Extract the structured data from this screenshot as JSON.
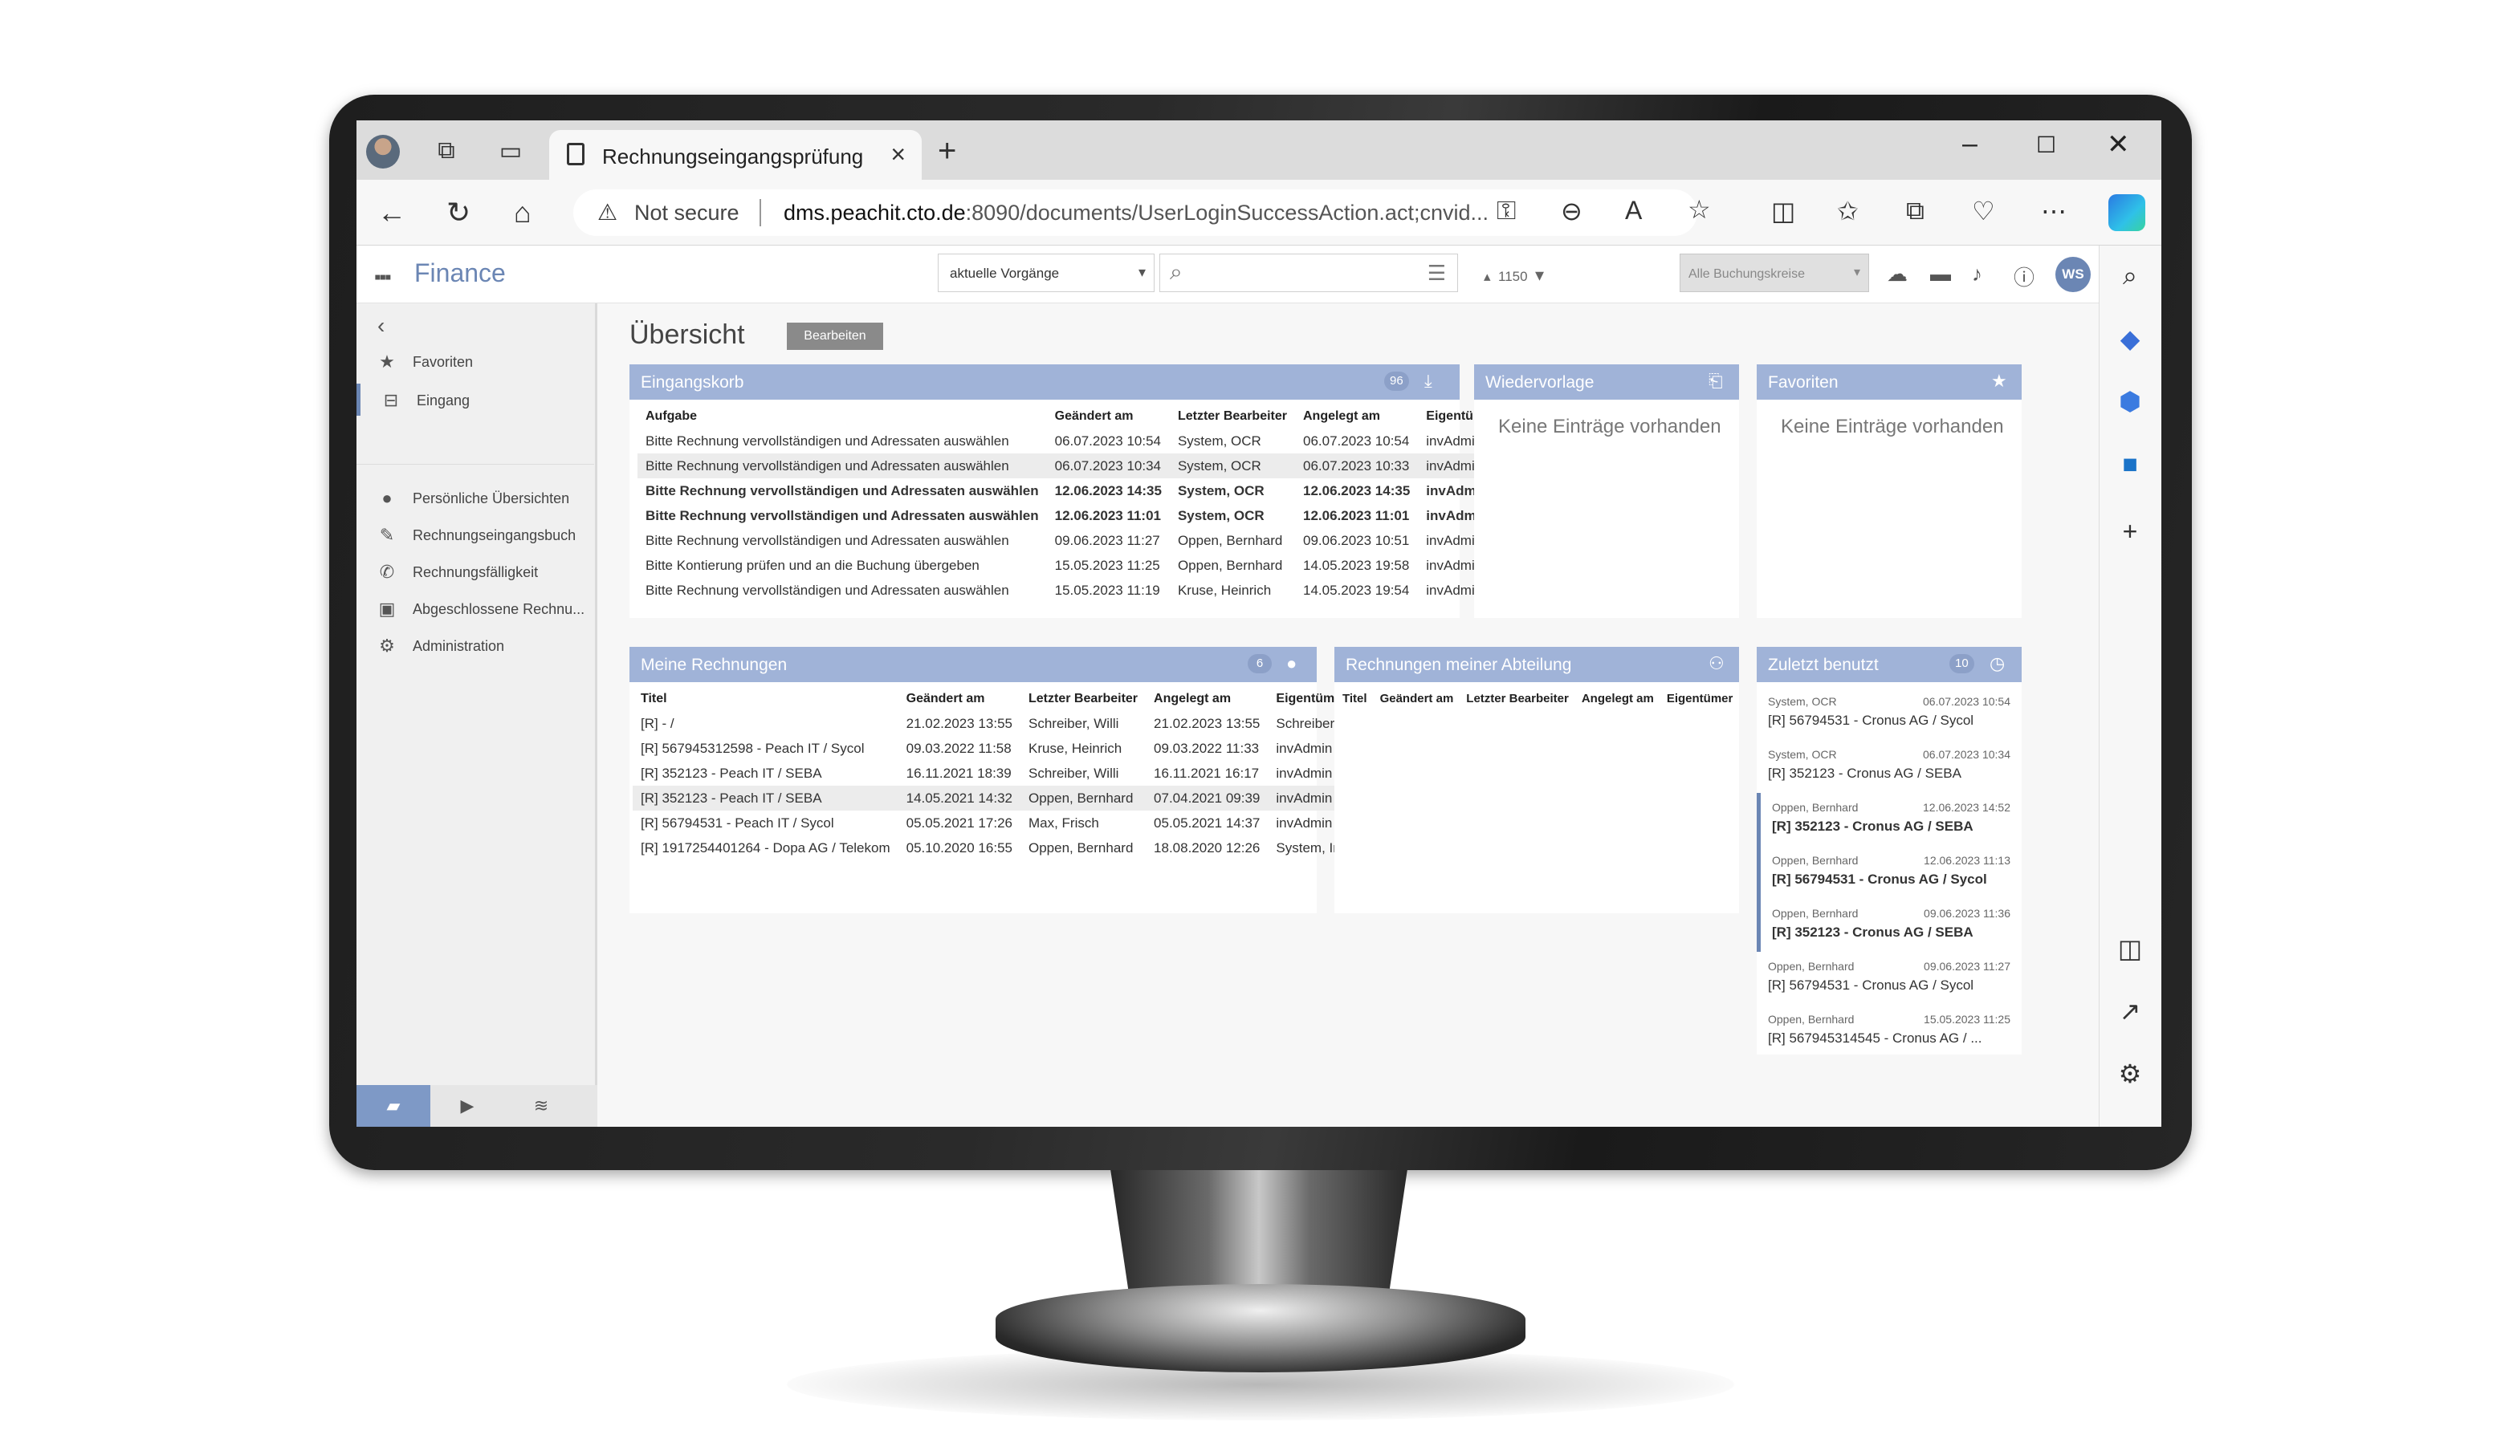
{
  "browser": {
    "tab_title": "Rechnungseingangsprüfung",
    "not_secure": "Not secure",
    "url_host": "dms.peachit.cto.de",
    "url_rest": ":8090/documents/UserLoginSuccessAction.act;cnvid..."
  },
  "app": {
    "title": "Finance",
    "filter_value": "aktuelle Vorgänge",
    "pager": "1150",
    "buchungskreis_value": "Alle Buchungskreise",
    "user_initials": "WS"
  },
  "sidebar": {
    "items": [
      {
        "label": "Favoriten",
        "icon": "star-icon"
      },
      {
        "label": "Eingang",
        "icon": "inbox-icon"
      },
      {
        "label": "Persönliche Übersichten",
        "icon": "person-icon"
      },
      {
        "label": "Rechnungseingangsbuch",
        "icon": "book-icon"
      },
      {
        "label": "Rechnungsfälligkeit",
        "icon": "due-icon"
      },
      {
        "label": "Abgeschlossene Rechnu...",
        "icon": "archive-icon"
      },
      {
        "label": "Administration",
        "icon": "gear-icon"
      }
    ]
  },
  "main": {
    "page_title": "Übersicht",
    "edit_label": "Bearbeiten"
  },
  "eingangskorb": {
    "title": "Eingangskorb",
    "count": "96",
    "columns": [
      "Aufgabe",
      "Geändert am",
      "Letzter Bearbeiter",
      "Angelegt am",
      "Eigentümer"
    ],
    "rows": [
      [
        "Bitte Rechnung vervollständigen und Adressaten auswählen",
        "06.07.2023 10:54",
        "System, OCR",
        "06.07.2023 10:54",
        "invAdmin"
      ],
      [
        "Bitte Rechnung vervollständigen und Adressaten auswählen",
        "06.07.2023 10:34",
        "System, OCR",
        "06.07.2023 10:33",
        "invAdmin"
      ],
      [
        "Bitte Rechnung vervollständigen und Adressaten auswählen",
        "12.06.2023 14:35",
        "System, OCR",
        "12.06.2023 14:35",
        "invAdmin"
      ],
      [
        "Bitte Rechnung vervollständigen und Adressaten auswählen",
        "12.06.2023 11:01",
        "System, OCR",
        "12.06.2023 11:01",
        "invAdmin"
      ],
      [
        "Bitte Rechnung vervollständigen und Adressaten auswählen",
        "09.06.2023 11:27",
        "Oppen, Bernhard",
        "09.06.2023 10:51",
        "invAdmin"
      ],
      [
        "Bitte Kontierung prüfen und an die Buchung übergeben",
        "15.05.2023 11:25",
        "Oppen, Bernhard",
        "14.05.2023 19:58",
        "invAdmin"
      ],
      [
        "Bitte Rechnung vervollständigen und Adressaten auswählen",
        "15.05.2023 11:19",
        "Kruse, Heinrich",
        "14.05.2023 19:54",
        "invAdmin"
      ]
    ]
  },
  "wiedervorlage": {
    "title": "Wiedervorlage",
    "empty": "Keine Einträge vorhanden"
  },
  "favoriten": {
    "title": "Favoriten",
    "empty": "Keine Einträge vorhanden"
  },
  "meine_rechnungen": {
    "title": "Meine Rechnungen",
    "count": "6",
    "columns": [
      "Titel",
      "Geändert am",
      "Letzter Bearbeiter",
      "Angelegt am",
      "Eigentümer"
    ],
    "rows": [
      [
        "[R] - /",
        "21.02.2023 13:55",
        "Schreiber, Willi",
        "21.02.2023 13:55",
        "Schreiber, W"
      ],
      [
        "[R] 567945312598 - Peach IT / Sycol",
        "09.03.2022 11:58",
        "Kruse, Heinrich",
        "09.03.2022 11:33",
        "invAdmin"
      ],
      [
        "[R] 352123 - Peach IT / SEBA",
        "16.11.2021 18:39",
        "Schreiber, Willi",
        "16.11.2021 16:17",
        "invAdmin"
      ],
      [
        "[R] 352123 - Peach IT / SEBA",
        "14.05.2021 14:32",
        "Oppen, Bernhard",
        "07.04.2021 09:39",
        "invAdmin"
      ],
      [
        "[R] 56794531 - Peach IT / Sycol",
        "05.05.2021 17:26",
        "Max, Frisch",
        "05.05.2021 14:37",
        "invAdmin"
      ],
      [
        "[R] 1917254401264 - Dopa AG / Telekom",
        "05.10.2020 16:55",
        "Oppen, Bernhard",
        "18.08.2020 12:26",
        "System, Imp"
      ]
    ]
  },
  "abteilung": {
    "title": "Rechnungen meiner Abteilung",
    "columns": [
      "Titel",
      "Geändert am",
      "Letzter Bearbeiter",
      "Angelegt am",
      "Eigentümer"
    ]
  },
  "zuletzt": {
    "title": "Zuletzt benutzt",
    "count": "10",
    "items": [
      {
        "user": "System, OCR",
        "date": "06.07.2023 10:54",
        "title": "[R] 56794531 - Cronus AG / Sycol",
        "bold": false
      },
      {
        "user": "System, OCR",
        "date": "06.07.2023 10:34",
        "title": "[R] 352123 - Cronus AG / SEBA",
        "bold": false
      },
      {
        "user": "Oppen, Bernhard",
        "date": "12.06.2023 14:52",
        "title": "[R] 352123 - Cronus AG / SEBA",
        "bold": true
      },
      {
        "user": "Oppen, Bernhard",
        "date": "12.06.2023 11:13",
        "title": "[R] 56794531 - Cronus AG / Sycol",
        "bold": true
      },
      {
        "user": "Oppen, Bernhard",
        "date": "09.06.2023 11:36",
        "title": "[R] 352123 - Cronus AG / SEBA",
        "bold": true
      },
      {
        "user": "Oppen, Bernhard",
        "date": "09.06.2023 11:27",
        "title": "[R] 56794531 - Cronus AG / Sycol",
        "bold": false
      },
      {
        "user": "Oppen, Bernhard",
        "date": "15.05.2023 11:25",
        "title": "[R] 567945314545 - Cronus AG / ...",
        "bold": false
      }
    ]
  }
}
